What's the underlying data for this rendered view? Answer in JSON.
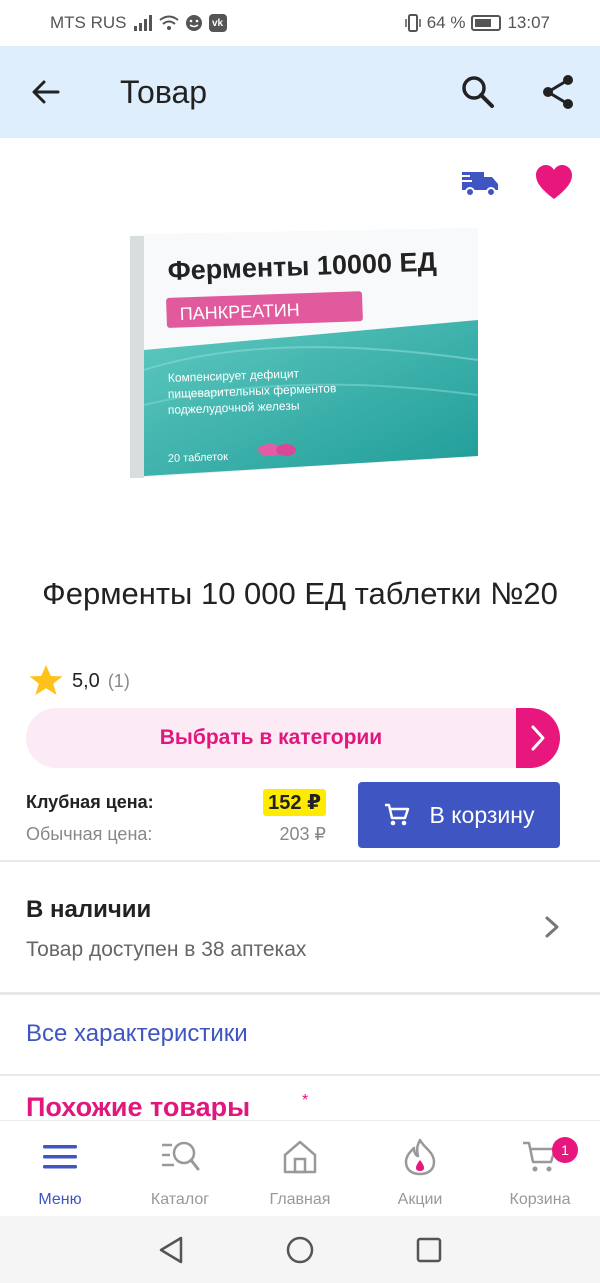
{
  "status_bar": {
    "carrier": "MTS RUS",
    "battery": "64 %",
    "time": "13:07"
  },
  "app_bar": {
    "title": "Товар"
  },
  "product": {
    "box_brand": "Ферменты 10000 ЕД",
    "box_badge": "ПАНКРЕАТИН",
    "box_desc_1": "Компенсирует дефицит",
    "box_desc_2": "пищеварительных ферментов",
    "box_desc_3": "поджелудочной железы",
    "box_count": "20 таблеток",
    "name": "Ферменты 10 000 ЕД таблетки №20",
    "rating": "5,0",
    "rating_count": "(1)"
  },
  "category_button": {
    "label": "Выбрать в категории"
  },
  "prices": {
    "club_label": "Клубная цена:",
    "club_price": "152 ₽",
    "regular_label": "Обычная цена:",
    "regular_price": "203 ₽"
  },
  "cart_button": {
    "label": "В корзину"
  },
  "stock": {
    "title": "В наличии",
    "subtitle": "Товар доступен в 38 аптеках"
  },
  "links": {
    "all_specs": "Все характеристики",
    "similar": "Похожие товары",
    "similar_mark": "*"
  },
  "bottom_nav": {
    "items": [
      {
        "label": "Меню",
        "icon": "menu-icon"
      },
      {
        "label": "Каталог",
        "icon": "catalog-icon"
      },
      {
        "label": "Главная",
        "icon": "home-icon"
      },
      {
        "label": "Акции",
        "icon": "promo-icon"
      },
      {
        "label": "Корзина",
        "icon": "cart-icon"
      }
    ],
    "cart_badge": "1"
  },
  "colors": {
    "accent_blue": "#3e55c2",
    "accent_pink": "#e8177d",
    "app_bar_bg": "#dfeefc",
    "price_highlight": "#ffeb00"
  }
}
